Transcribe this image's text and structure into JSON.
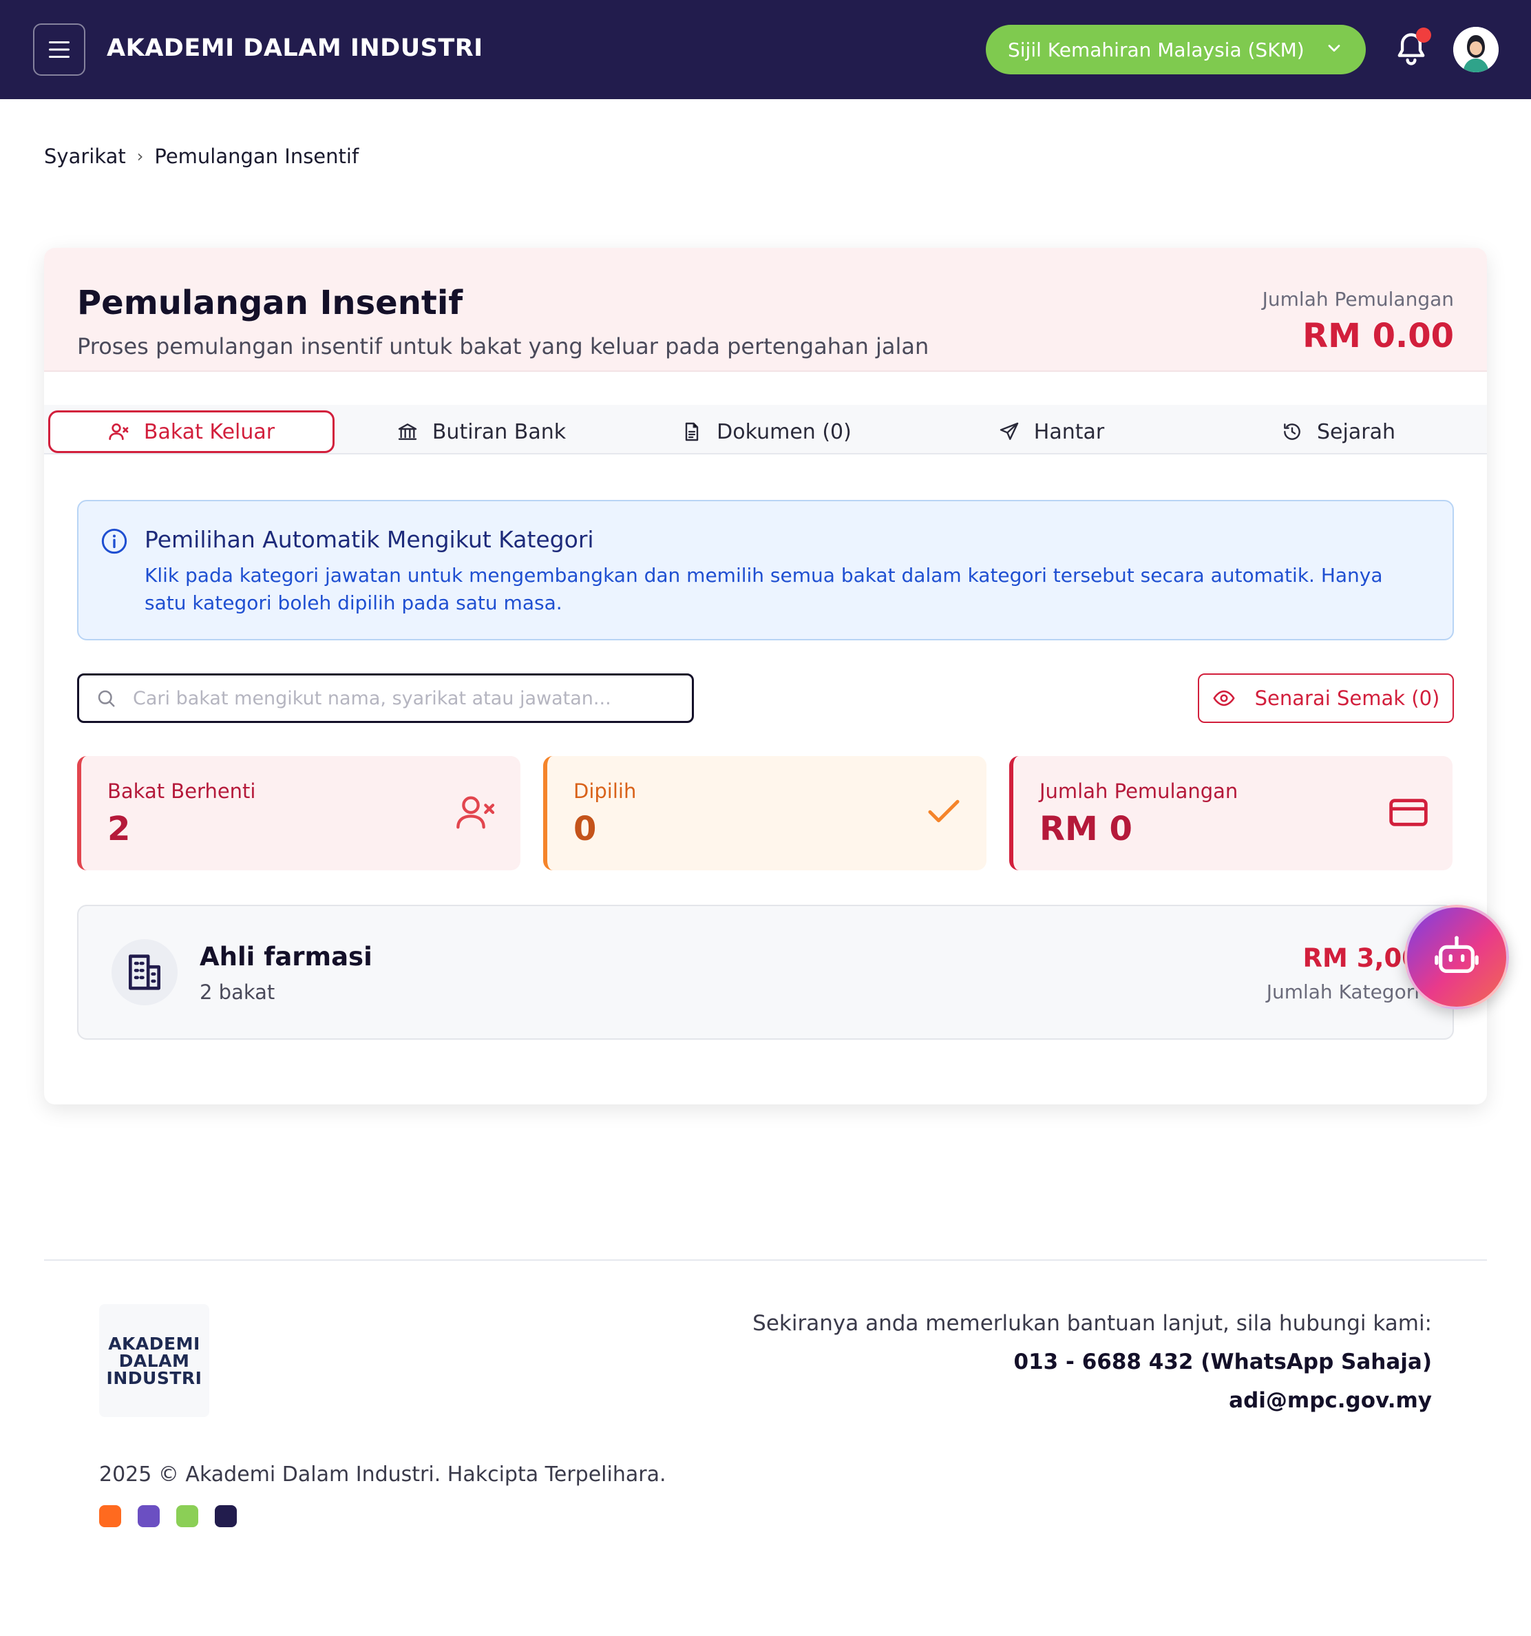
{
  "header": {
    "brand": "AKADEMI DALAM INDUSTRI",
    "program_selector": "Sijil Kemahiran Malaysia (SKM)",
    "colors": {
      "bar": "#221c4d",
      "selector": "#7fca4f",
      "notification_dot": "#f03e3e"
    }
  },
  "breadcrumb": {
    "parent": "Syarikat",
    "separator": "›",
    "current": "Pemulangan Insentif"
  },
  "page": {
    "title": "Pemulangan Insentif",
    "subtitle": "Proses pemulangan insentif untuk bakat yang keluar pada pertengahan jalan",
    "total_label": "Jumlah Pemulangan",
    "total_value": "RM 0.00"
  },
  "tabs": [
    {
      "label": "Bakat Keluar",
      "icon": "user-x-icon",
      "active": true
    },
    {
      "label": "Butiran Bank",
      "icon": "bank-icon",
      "active": false
    },
    {
      "label": "Dokumen (0)",
      "icon": "document-icon",
      "active": false
    },
    {
      "label": "Hantar",
      "icon": "send-icon",
      "active": false
    },
    {
      "label": "Sejarah",
      "icon": "history-icon",
      "active": false
    }
  ],
  "info": {
    "title": "Pemilihan Automatik Mengikut Kategori",
    "text": "Klik pada kategori jawatan untuk mengembangkan dan memilih semua bakat dalam kategori tersebut secara automatik. Hanya satu kategori boleh dipilih pada satu masa."
  },
  "search": {
    "placeholder": "Cari bakat mengikut nama, syarikat atau jawatan...",
    "value": ""
  },
  "checklist_button": "Senarai Semak (0)",
  "stats": [
    {
      "label": "Bakat Berhenti",
      "value": "2",
      "icon": "user-x-icon"
    },
    {
      "label": "Dipilih",
      "value": "0",
      "icon": "check-icon"
    },
    {
      "label": "Jumlah Pemulangan",
      "value": "RM 0",
      "icon": "credit-card-icon"
    }
  ],
  "categories": [
    {
      "name": "Ahli farmasi",
      "count": "2 bakat",
      "amount": "RM 3,00",
      "amount_label": "Jumlah Kategori"
    }
  ],
  "footer": {
    "logo_lines": [
      "AKADEMI",
      "DALAM",
      "INDUSTRI"
    ],
    "help_text": "Sekiranya anda memerlukan bantuan lanjut, sila hubungi kami:",
    "phone": "013 - 6688 432 (WhatsApp Sahaja)",
    "email": "adi@mpc.gov.my",
    "copyright": "2025 © Akademi Dalam Industri. Hakcipta Terpelihara.",
    "swatches": [
      "#ff6a1f",
      "#6b4fc2",
      "#8bcf56",
      "#221c4d"
    ]
  }
}
